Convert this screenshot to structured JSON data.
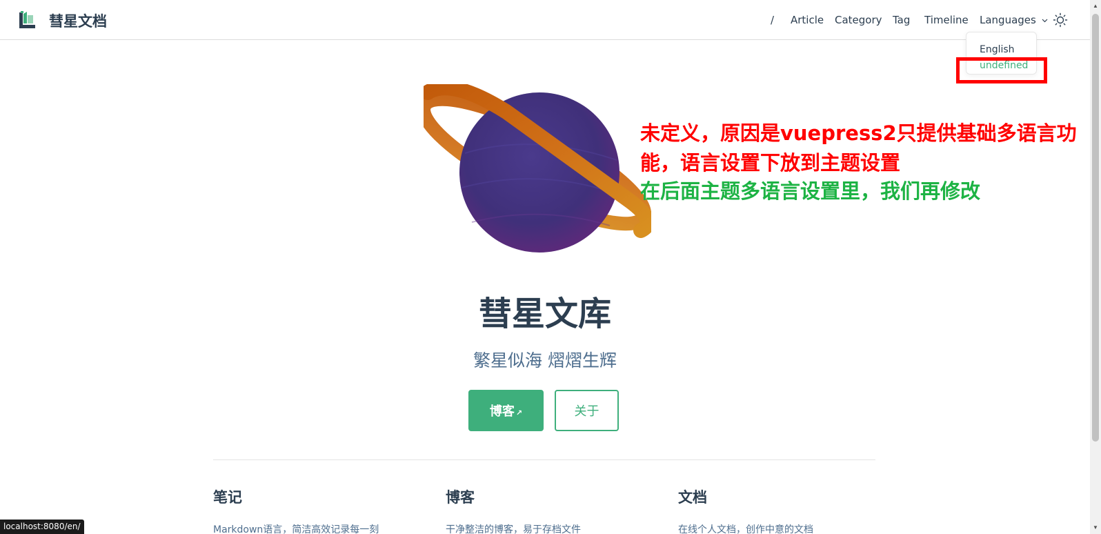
{
  "navbar": {
    "site_name": "彗星文档",
    "links": [
      "/",
      "Article",
      "Category",
      "Tag",
      "Timeline"
    ],
    "languages_label": "Languages",
    "languages_dropdown": [
      "English",
      "undefined"
    ]
  },
  "hero": {
    "title": "彗星文库",
    "tagline": "繁星似海 熠熠生辉",
    "primary_button": "博客",
    "primary_button_icon": "↗",
    "secondary_button": "关于"
  },
  "features": [
    {
      "title": "笔记",
      "desc": "Markdown语言，简洁高效记录每一刻"
    },
    {
      "title": "博客",
      "desc": "干净整洁的博客，易于存档文件"
    },
    {
      "title": "文档",
      "desc": "在线个人文档，创作中意的文档"
    }
  ],
  "annotation": {
    "red_line1": "未定义，原因是vuepress2只提供基础多语言功",
    "red_line2": "能，语言设置下放到主题设置",
    "green_line": "在后面主题多语言设置里，我们再修改"
  },
  "status_url": "localhost:8080/en/",
  "colors": {
    "accent": "#3eaf7c",
    "annotation_red": "#ff0000",
    "annotation_green": "#1db344"
  },
  "icons": [
    "logo-icon",
    "sun-icon",
    "chevron-down-icon",
    "external-link-icon",
    "planet-illustration"
  ]
}
